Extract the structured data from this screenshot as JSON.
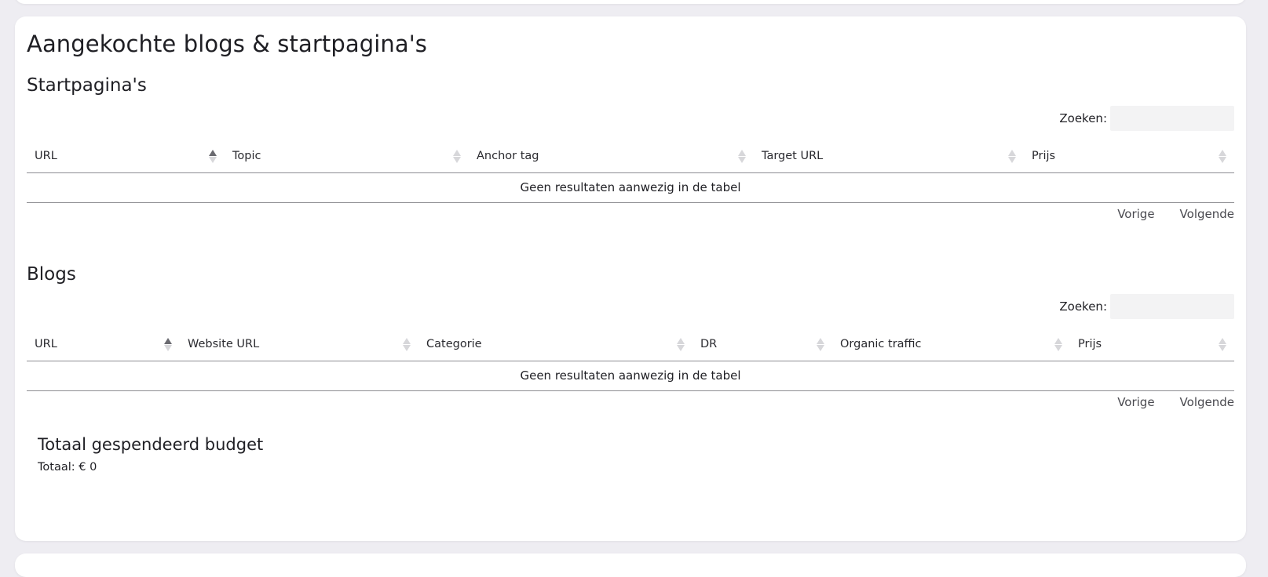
{
  "page": {
    "title": "Aangekochte blogs & startpagina's"
  },
  "startpaginas": {
    "title": "Startpagina's",
    "search_label": "Zoeken:",
    "search_placeholder": "",
    "columns": [
      "URL",
      "Topic",
      "Anchor tag",
      "Target URL",
      "Prijs"
    ],
    "empty_text": "Geen resultaten aanwezig in de tabel",
    "prev": "Vorige",
    "next": "Volgende"
  },
  "blogs": {
    "title": "Blogs",
    "search_label": "Zoeken:",
    "search_placeholder": "",
    "columns": [
      "URL",
      "Website URL",
      "Categorie",
      "DR",
      "Organic traffic",
      "Prijs"
    ],
    "empty_text": "Geen resultaten aanwezig in de tabel",
    "prev": "Vorige",
    "next": "Volgende"
  },
  "budget": {
    "title": "Totaal gespendeerd budget",
    "total": "Totaal: € 0"
  },
  "colors": {
    "background": "#eeedf2",
    "card": "#ffffff",
    "search_field": "#f3f3f4",
    "table_border": "#8d8d92",
    "sort_active": "#6a6a70",
    "sort_inactive": "#d7d7da"
  },
  "icons": {
    "sort_ascending": "sort-ascending-icon",
    "sort_neutral": "sort-neutral-icon"
  }
}
